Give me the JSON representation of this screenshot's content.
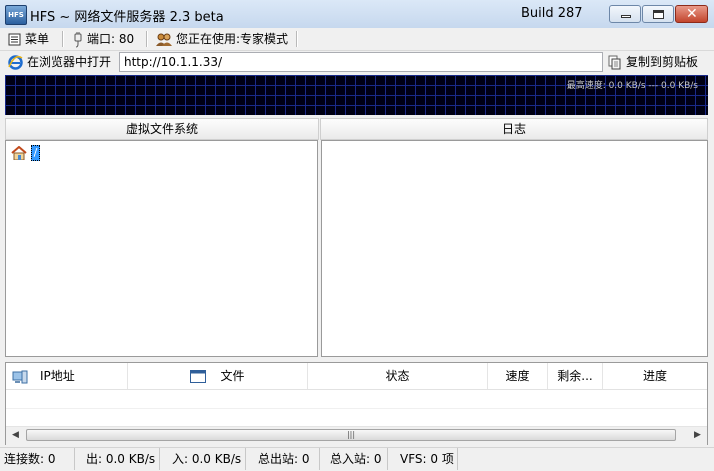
{
  "window": {
    "title": "HFS ~ 网络文件服务器 2.3 beta",
    "build": "Build 287",
    "icon_text": "HFS",
    "controls": [
      "minimize-icon",
      "maximize-icon",
      "close-icon"
    ]
  },
  "menubar": {
    "menu_label": "菜单",
    "port_label": "端口: 80",
    "mode_label": "您正在使用:专家模式"
  },
  "urlbar": {
    "open_label": "在浏览器中打开",
    "url_value": "http://10.1.1.33/",
    "copy_label": "复制到剪贴板"
  },
  "graph": {
    "speed_label": "最高速度: 0.0 KB/s --- 0.0 KB/s"
  },
  "panels": {
    "vfs_title": "虚拟文件系统",
    "log_title": "日志",
    "vfs_root": "/"
  },
  "connections": {
    "columns": [
      "IP地址",
      "文件",
      "状态",
      "速度",
      "剩余...",
      "进度"
    ]
  },
  "statusbar": {
    "connections": "连接数: 0",
    "out": "出: 0.0 KB/s",
    "in": "入: 0.0 KB/s",
    "total_out": "总出站: 0",
    "total_in": "总入站: 0",
    "vfs": "VFS: 0 项"
  },
  "colors": {
    "graph_bg": "#000014",
    "graph_grid": "#1a2a8a",
    "selection": "#3399ff",
    "close_button": "#c2452d"
  }
}
